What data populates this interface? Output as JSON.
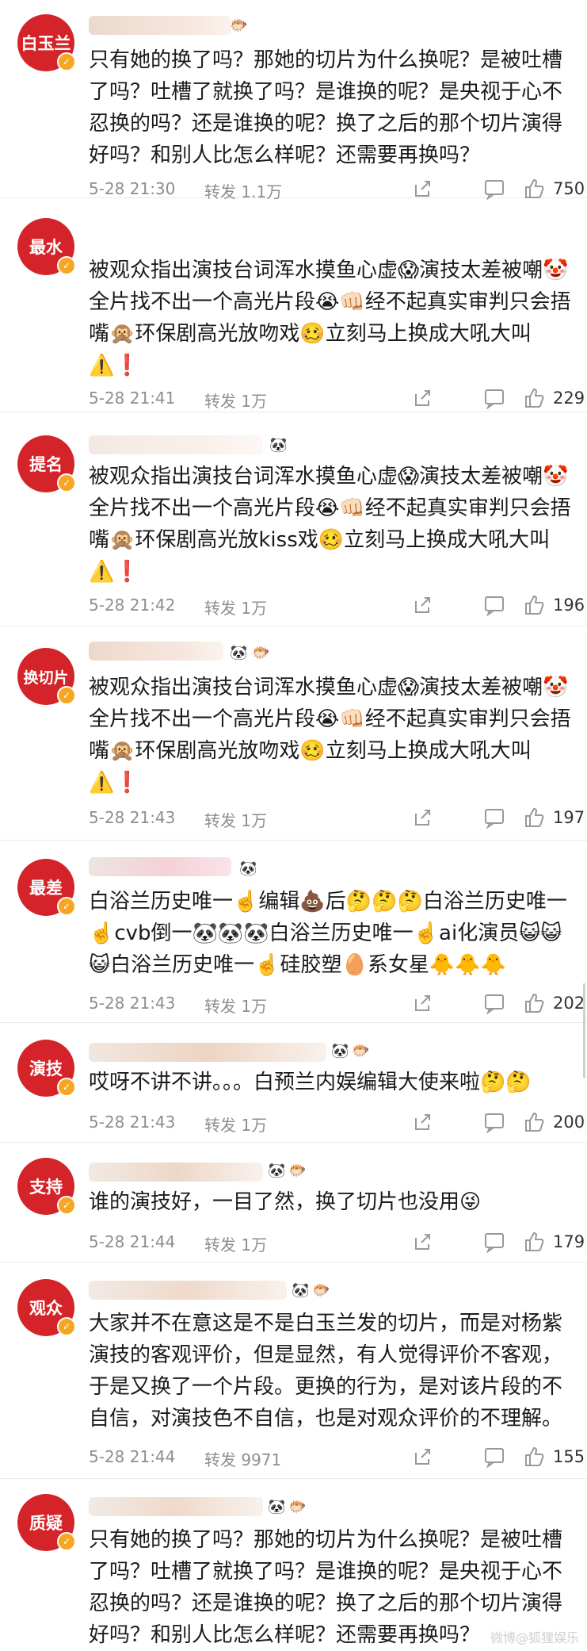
{
  "posts": [
    {
      "avatar": "白玉兰",
      "text": "只有她的换了吗？那她的切片为什么换呢？是被吐槽了吗？吐槽了就换了吗？是谁换的呢？是央视于心不忍换的吗？还是谁换的呢？换了之后的那个切片演得好吗？和别人比怎么样呢？还需要再换吗？",
      "time": "5-28 21:30",
      "repost": "转发 1.1万",
      "likes": "750"
    },
    {
      "avatar": "最水",
      "text": "被观众指出演技台词浑水摸鱼心虚😱演技太差被嘲🤡全片找不出一个高光片段😭👊🏻经不起真实审判只会捂嘴🙊环保剧高光放吻戏🥴立刻马上换成大吼大叫⚠️❗",
      "time": "5-28 21:41",
      "repost": "转发 1万",
      "likes": "229"
    },
    {
      "avatar": "提名",
      "text": "被观众指出演技台词浑水摸鱼心虚😱演技太差被嘲🤡全片找不出一个高光片段😭👊🏻经不起真实审判只会捂嘴🙊环保剧高光放kiss戏🥴立刻马上换成大吼大叫⚠️❗",
      "time": "5-28 21:42",
      "repost": "转发 1万",
      "likes": "196"
    },
    {
      "avatar": "换切片",
      "text": "被观众指出演技台词浑水摸鱼心虚😱演技太差被嘲🤡全片找不出一个高光片段😭👊🏻经不起真实审判只会捂嘴🙊环保剧高光放吻戏🥴立刻马上换成大吼大叫⚠️❗",
      "time": "5-28 21:43",
      "repost": "转发 1万",
      "likes": "197"
    },
    {
      "avatar": "最差",
      "text": "白浴兰历史唯一☝️编辑💩后🤔🤔🤔白浴兰历史唯一☝️cvb倒一🐼🐼🐼白浴兰历史唯一☝️ai化演员😺😺😺白浴兰历史唯一☝️硅胶塑🥚系女星🐥🐥🐥",
      "time": "5-28 21:43",
      "repost": "转发 1万",
      "likes": "202"
    },
    {
      "avatar": "演技",
      "text": "哎呀不讲不讲。。。白预兰内娱编辑大使来啦🤔🤔",
      "time": "5-28 21:43",
      "repost": "转发 1万",
      "likes": "200"
    },
    {
      "avatar": "支持",
      "text": "谁的演技好，一目了然，换了切片也没用😜",
      "time": "5-28 21:44",
      "repost": "转发 1万",
      "likes": "179"
    },
    {
      "avatar": "观众",
      "text": "大家并不在意这是不是白玉兰发的切片，而是对杨紫演技的客观评价，但是显然，有人觉得评价不客观，于是又换了一个片段。更换的行为，是对该片段的不自信，对演技色不自信，也是对观众评价的不理解。",
      "time": "5-28 21:44",
      "repost": "转发 9971",
      "likes": "155"
    },
    {
      "avatar": "质疑",
      "text": "只有她的换了吗？那她的切片为什么换呢？是被吐槽了吗？吐槽了就换了吗？是谁换的呢？是央视于心不忍换的吗？还是谁换的呢？换了之后的那个切片演得好吗？和别人比怎么样呢？还需要再换吗？",
      "time": "",
      "repost": "",
      "likes": ""
    }
  ],
  "icons": {
    "verified": "verified-badge-icon",
    "share": "share-icon",
    "comment": "comment-icon",
    "like": "thumbs-up-icon"
  },
  "colors": {
    "avatar_red": "#d4242a",
    "badge_orange": "#f6a623",
    "meta_gray": "#8e8e8e"
  },
  "watermark": "微博@狐狸娱乐"
}
